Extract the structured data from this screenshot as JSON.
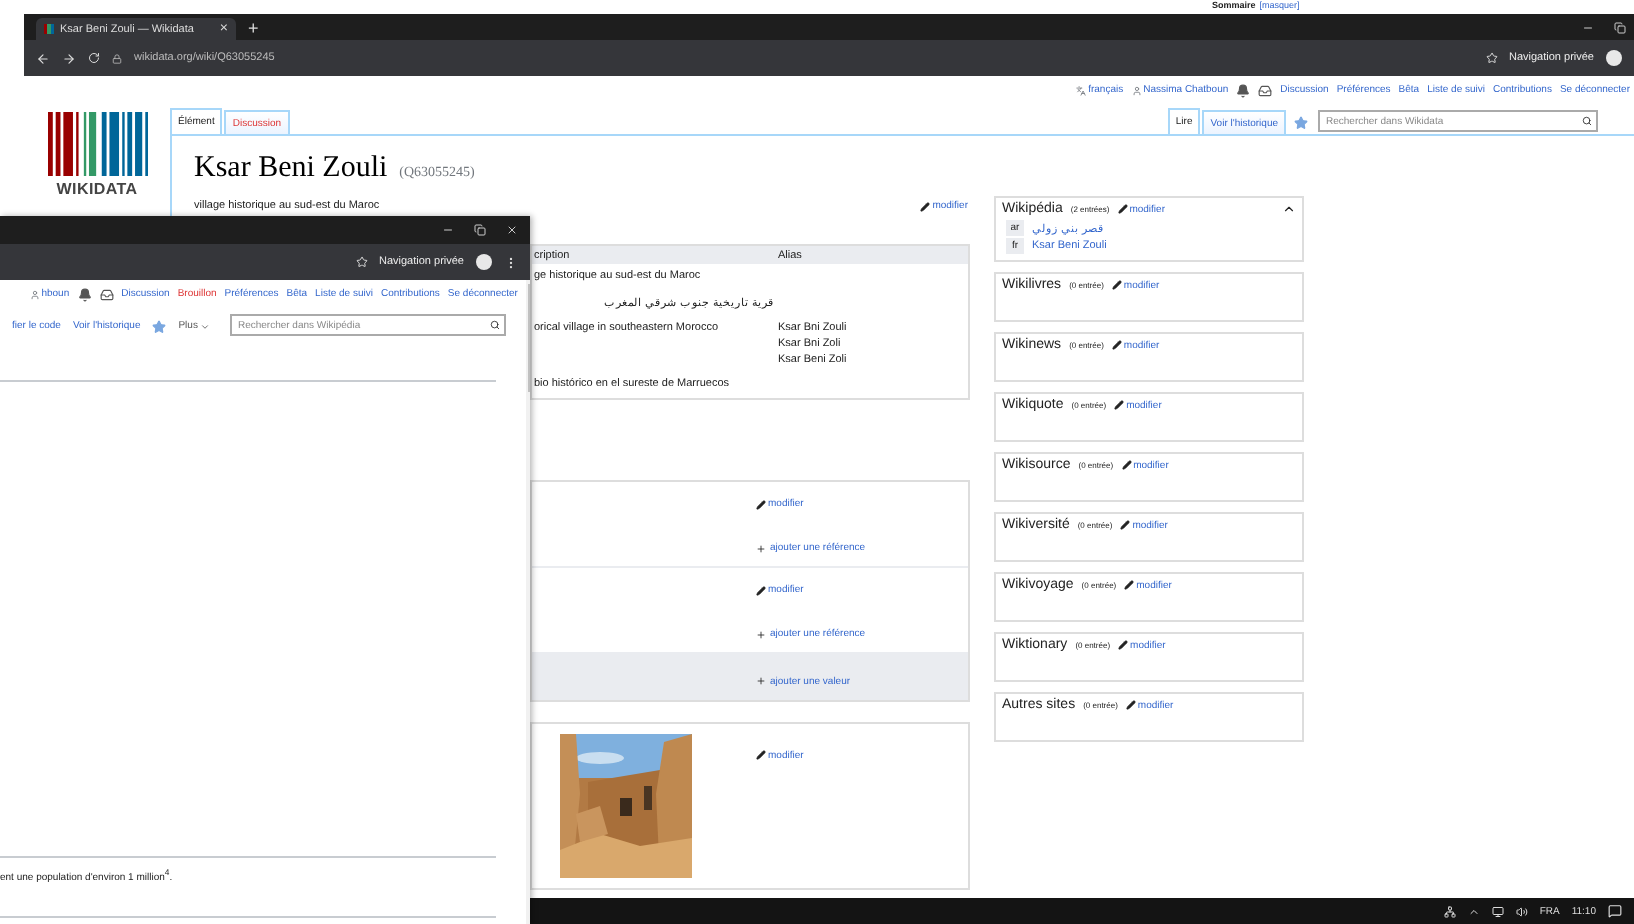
{
  "background_window": {
    "heading": "Sommaire",
    "toggle": "[masquer]"
  },
  "wikidata_window": {
    "tab_title": "Ksar Beni Zouli — Wikidata",
    "tab_close": "×",
    "new_tab": "+",
    "address": "wikidata.org/wiki/Q63055245",
    "profile": "Navigation privée",
    "personal_links": [
      {
        "kind": "language",
        "label": "français",
        "missing": false
      },
      {
        "kind": "user",
        "label": "Nassima Chatboun",
        "missing": false
      },
      {
        "kind": "bell",
        "missing": false
      },
      {
        "kind": "tray",
        "missing": false
      },
      {
        "kind": "link",
        "label": "Discussion",
        "missing": false
      },
      {
        "kind": "link",
        "label": "Préférences",
        "missing": false
      },
      {
        "kind": "link",
        "label": "Bêta",
        "missing": false
      },
      {
        "kind": "link",
        "label": "Liste de suivi",
        "missing": false
      },
      {
        "kind": "link",
        "label": "Contributions",
        "missing": false
      },
      {
        "kind": "link",
        "label": "Se déconnecter",
        "missing": false
      }
    ],
    "logo_wordmark": "WIKIDATA",
    "page_tabs": [
      {
        "label": "Élément",
        "selected": true,
        "missing": false
      },
      {
        "label": "Discussion",
        "selected": false,
        "missing": true
      }
    ],
    "view_tabs": [
      {
        "label": "Lire",
        "selected": true
      },
      {
        "label": "Voir l'historique",
        "selected": false
      }
    ],
    "search_placeholder": "Rechercher dans Wikidata",
    "title": "Ksar Beni Zouli",
    "item_id": "(Q63055245)",
    "description": "village historique au sud-est du Maroc",
    "description_edit": "modifier",
    "terms": {
      "columns": [
        "cription",
        "Alias"
      ],
      "rows": [
        {
          "description": "ge historique au sud-est du Maroc",
          "rtl": false,
          "aliases": []
        },
        {
          "description": "قرية تاريخية جنوب شرقي المغرب",
          "rtl": true,
          "aliases": []
        },
        {
          "description": "orical village in southeastern Morocco",
          "rtl": false,
          "aliases": [
            "Ksar Bni Zouli",
            "Ksar Bni Zoli",
            "Ksar Beni Zoli"
          ]
        },
        {
          "description": "bio histórico en el sureste de Marruecos",
          "rtl": false,
          "aliases": []
        }
      ]
    },
    "statements": [
      {
        "edit": "modifier",
        "add_reference": "ajouter une référence"
      },
      {
        "edit": "modifier",
        "add_reference": "ajouter une référence"
      }
    ],
    "add_value": "ajouter une valeur",
    "image_statement": {
      "edit": "modifier"
    },
    "sitelinks": [
      {
        "name": "Wikipédia",
        "count": "(2 entrées)",
        "edit": "modifier",
        "expanded": true,
        "links": [
          {
            "lang": "ar",
            "title": "قصر بني زولي",
            "rtl": true
          },
          {
            "lang": "fr",
            "title": "Ksar Beni Zouli",
            "rtl": false
          }
        ]
      },
      {
        "name": "Wikilivres",
        "count": "(0 entrée)",
        "edit": "modifier",
        "expanded": false
      },
      {
        "name": "Wikinews",
        "count": "(0 entrée)",
        "edit": "modifier",
        "expanded": false
      },
      {
        "name": "Wikiquote",
        "count": "(0 entrée)",
        "edit": "modifier",
        "expanded": false
      },
      {
        "name": "Wikisource",
        "count": "(0 entrée)",
        "edit": "modifier",
        "expanded": false
      },
      {
        "name": "Wikiversité",
        "count": "(0 entrée)",
        "edit": "modifier",
        "expanded": false
      },
      {
        "name": "Wikivoyage",
        "count": "(0 entrée)",
        "edit": "modifier",
        "expanded": false
      },
      {
        "name": "Wiktionary",
        "count": "(0 entrée)",
        "edit": "modifier",
        "expanded": false
      },
      {
        "name": "Autres sites",
        "count": "(0 entrée)",
        "edit": "modifier",
        "expanded": false
      }
    ]
  },
  "wikipedia_window": {
    "profile": "Navigation privée",
    "personal_links": [
      {
        "kind": "user",
        "label": "hboun",
        "missing": false
      },
      {
        "kind": "bell",
        "missing": false
      },
      {
        "kind": "tray",
        "missing": false
      },
      {
        "kind": "link",
        "label": "Discussion",
        "missing": false
      },
      {
        "kind": "link",
        "label": "Brouillon",
        "missing": true
      },
      {
        "kind": "link",
        "label": "Préférences",
        "missing": false
      },
      {
        "kind": "link",
        "label": "Bêta",
        "missing": false
      },
      {
        "kind": "link",
        "label": "Liste de suivi",
        "missing": false
      },
      {
        "kind": "link",
        "label": "Contributions",
        "missing": false
      },
      {
        "kind": "link",
        "label": "Se déconnecter",
        "missing": false
      }
    ],
    "view_tabs": [
      {
        "label": "fier le code"
      },
      {
        "label": "Voir l'historique"
      }
    ],
    "more": "Plus",
    "search_placeholder": "Rechercher dans Wikipédia",
    "footer_text": "ent une population d'environ 1 million$^{4}$."
  },
  "taskbar": {
    "language": "FRA",
    "time": "11:10"
  }
}
